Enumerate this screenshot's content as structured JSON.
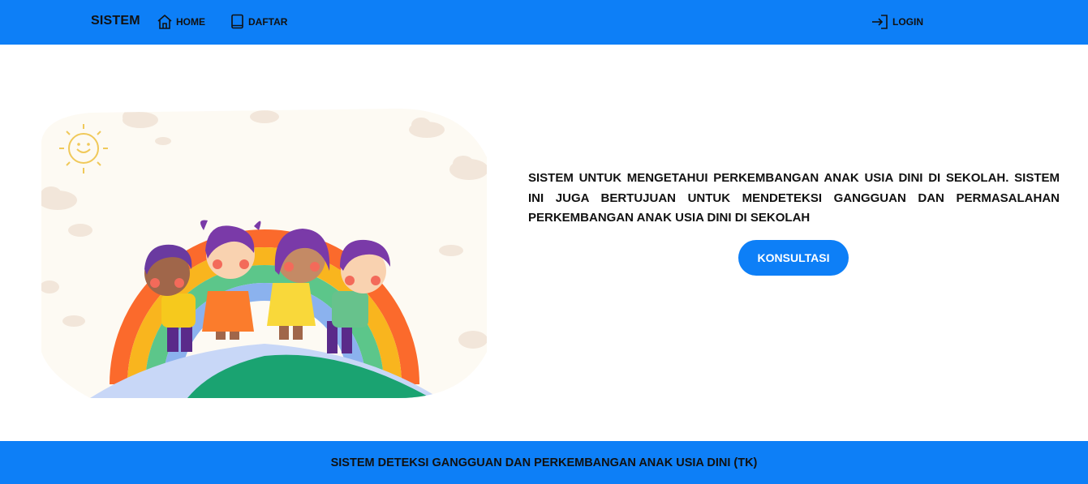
{
  "navbar": {
    "brand": "SISTEM",
    "home_label": "HOME",
    "daftar_label": "DAFTAR",
    "login_label": "LOGIN",
    "icons": {
      "home": "home-icon",
      "daftar": "book-icon",
      "login": "login-icon"
    }
  },
  "hero": {
    "description": "SISTEM UNTUK MENGETAHUI PERKEMBANGAN ANAK USIA DINI DI SEKOLAH. SISTEM INI JUGA BERTUJUAN UNTUK MENDETEKSI GANGGUAN DAN PERMASALAHAN PERKEMBANGAN ANAK USIA DINI DI SEKOLAH",
    "button_label": "KONSULTASI"
  },
  "footer": {
    "text": "SISTEM DETEKSI GANGGUAN DAN PERKEMBANGAN ANAK USIA DINI (TK)"
  },
  "colors": {
    "primary": "#0d7ff7",
    "text_dark": "#111111",
    "background": "#ffffff"
  }
}
